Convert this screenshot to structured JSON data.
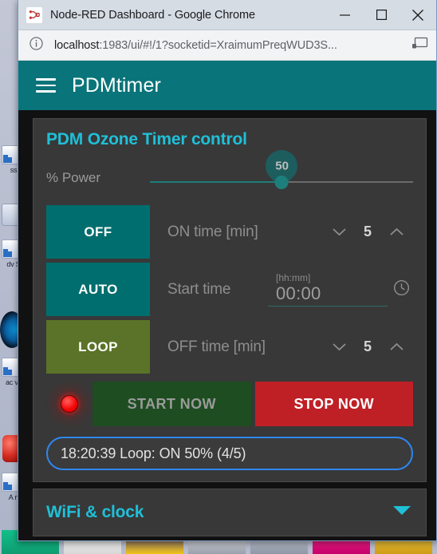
{
  "window": {
    "title": "Node-RED Dashboard - Google Chrome",
    "favicon_name": "node-red-icon",
    "minimize_label": "Minimize",
    "maximize_label": "Maximize",
    "close_label": "Close"
  },
  "toolbar": {
    "info_icon": "info-circle-icon",
    "url_host": "localhost",
    "url_rest": ":1983/ui/#!/1?socketid=XraimumPreqWUD3S...",
    "cast_icon": "cast-icon"
  },
  "appbar": {
    "menu_icon": "hamburger-menu-icon",
    "title": "PDMtimer"
  },
  "card": {
    "title": "PDM Ozone Timer control",
    "slider": {
      "label": "% Power",
      "value": "50",
      "min": 0,
      "max": 100,
      "percent": 50
    },
    "rows": [
      {
        "mode_label": "OFF",
        "mode_color": "#006e6e",
        "field_label": "ON time [min]",
        "value": "5",
        "decrement_icon": "chevron-down-icon",
        "increment_icon": "chevron-up-icon"
      },
      {
        "mode_label": "AUTO",
        "mode_color": "#006e6e",
        "field_label": "Start time",
        "time_hint": "[hh:mm]",
        "time_value": "00:00",
        "clock_icon": "clock-icon"
      },
      {
        "mode_label": "LOOP",
        "mode_color": "#5a7328",
        "field_label": "OFF time [min]",
        "value": "5",
        "decrement_icon": "chevron-down-icon",
        "increment_icon": "chevron-up-icon"
      }
    ],
    "actions": {
      "led_name": "status-led-red",
      "led_color": "#f50505",
      "start_label": "START NOW",
      "stop_label": "STOP NOW",
      "start_color": "#1d4d20",
      "stop_color": "#bf2026"
    },
    "status": {
      "text": "18:20:39 Loop: ON 50% (4/5)",
      "border_color": "#2f87f0"
    }
  },
  "wifi_card": {
    "title": "WiFi & clock",
    "chevron_icon": "chevron-down-icon"
  },
  "theme": {
    "accent_teal": "#097479",
    "title_cyan": "#1fc0d8",
    "card_bg": "#383838",
    "page_bg": "#111111"
  },
  "desktop": {
    "icons": [
      {
        "label": "ss"
      },
      {
        "label": "dv\nS"
      },
      {
        "label": "ac\nvs"
      },
      {
        "label": "A\nn"
      }
    ]
  }
}
